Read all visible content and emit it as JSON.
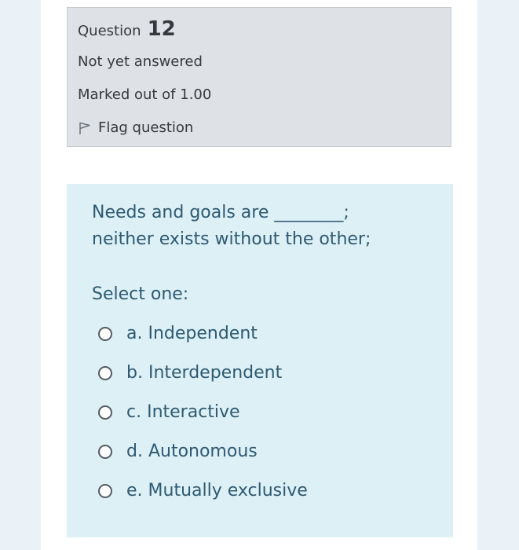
{
  "info": {
    "question_label": "Question",
    "question_number": "12",
    "state": "Not yet answered",
    "grade": "Marked out of 1.00",
    "flag_label": "Flag question"
  },
  "question": {
    "line1": "Needs and goals are ________;",
    "line2": "neither exists without the other;",
    "prompt": "Select one:"
  },
  "options": [
    {
      "label": "a. Independent",
      "selected": false
    },
    {
      "label": "b. Interdependent",
      "selected": false
    },
    {
      "label": "c. Interactive",
      "selected": false
    },
    {
      "label": "d. Autonomous",
      "selected": false
    },
    {
      "label": "e. Mutually exclusive",
      "selected": false
    }
  ],
  "colors": {
    "info_background": "#dee2e6",
    "formulation_background": "#dcf0f6",
    "text": "#2f5a72"
  },
  "icons": {
    "flag": "flag-icon"
  }
}
